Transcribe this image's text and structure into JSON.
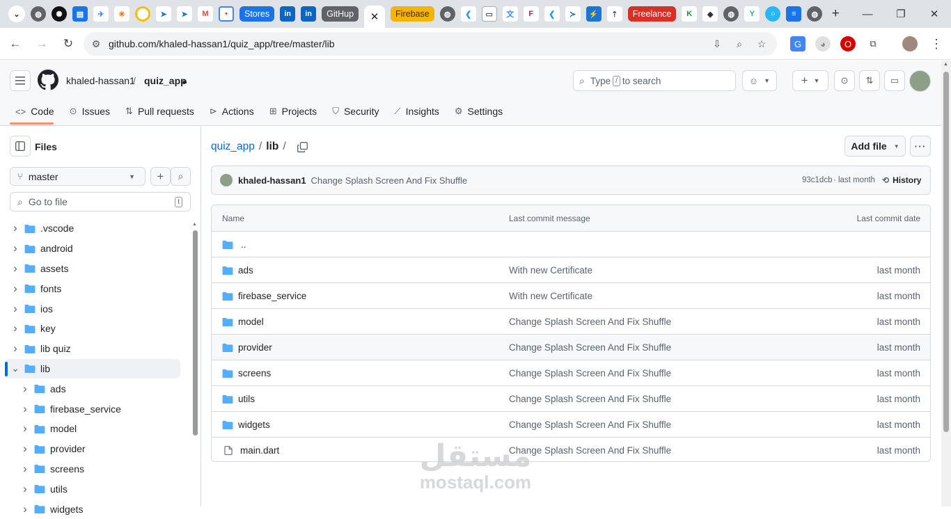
{
  "browser": {
    "tab_chips": [
      {
        "label": "Stores",
        "color": "#1a73e8"
      },
      {
        "label": "GitHup",
        "color": "#5f6368"
      },
      {
        "label": "Firebase",
        "color": "#f4b400"
      },
      {
        "label": "Freelance",
        "color": "#d93025"
      }
    ],
    "active_tab_close": "✕",
    "new_tab": "+",
    "url": "github.com/khaled-hassan1/quiz_app/tree/master/lib"
  },
  "header": {
    "owner": "khaled-hassan1",
    "separator": "/",
    "repo": "quiz_app",
    "search_placeholder_pre": "Type",
    "search_key": "/",
    "search_placeholder_post": "to search"
  },
  "repo_tabs": [
    {
      "label": "Code",
      "icon": "code-icon",
      "selected": true
    },
    {
      "label": "Issues",
      "icon": "issue-icon"
    },
    {
      "label": "Pull requests",
      "icon": "pull-request-icon"
    },
    {
      "label": "Actions",
      "icon": "play-icon"
    },
    {
      "label": "Projects",
      "icon": "table-icon"
    },
    {
      "label": "Security",
      "icon": "shield-icon"
    },
    {
      "label": "Insights",
      "icon": "graph-icon"
    },
    {
      "label": "Settings",
      "icon": "gear-icon"
    }
  ],
  "sidebar": {
    "title": "Files",
    "branch": "master",
    "goto_placeholder": "Go to file",
    "goto_key": "t",
    "tree": [
      {
        "label": ".vscode",
        "level": 0
      },
      {
        "label": "android",
        "level": 0
      },
      {
        "label": "assets",
        "level": 0
      },
      {
        "label": "fonts",
        "level": 0
      },
      {
        "label": "ios",
        "level": 0
      },
      {
        "label": "key",
        "level": 0
      },
      {
        "label": "lib quiz",
        "level": 0
      },
      {
        "label": "lib",
        "level": 0,
        "expanded": true,
        "selected": true
      },
      {
        "label": "ads",
        "level": 1
      },
      {
        "label": "firebase_service",
        "level": 1
      },
      {
        "label": "model",
        "level": 1
      },
      {
        "label": "provider",
        "level": 1
      },
      {
        "label": "screens",
        "level": 1
      },
      {
        "label": "utils",
        "level": 1
      },
      {
        "label": "widgets",
        "level": 1
      }
    ]
  },
  "main": {
    "path_repo": "quiz_app",
    "path_sep": "/",
    "path_dir": "lib",
    "path_trail": "/",
    "add_file": "Add file",
    "commit": {
      "author": "khaled-hassan1",
      "message": "Change Splash Screen And Fix Shuffle",
      "hash": "93c1dcb",
      "dot": "·",
      "when": "last month",
      "history": "History"
    },
    "columns": {
      "name": "Name",
      "message": "Last commit message",
      "date": "Last commit date"
    },
    "parent_dir": "..",
    "files": [
      {
        "name": "ads",
        "type": "dir",
        "message": "With new Certificate",
        "date": "last month"
      },
      {
        "name": "firebase_service",
        "type": "dir",
        "message": "With new Certificate",
        "date": "last month"
      },
      {
        "name": "model",
        "type": "dir",
        "message": "Change Splash Screen And Fix Shuffle",
        "date": "last month"
      },
      {
        "name": "provider",
        "type": "dir",
        "message": "Change Splash Screen And Fix Shuffle",
        "date": "last month"
      },
      {
        "name": "screens",
        "type": "dir",
        "message": "Change Splash Screen And Fix Shuffle",
        "date": "last month"
      },
      {
        "name": "utils",
        "type": "dir",
        "message": "Change Splash Screen And Fix Shuffle",
        "date": "last month"
      },
      {
        "name": "widgets",
        "type": "dir",
        "message": "Change Splash Screen And Fix Shuffle",
        "date": "last month"
      },
      {
        "name": "main.dart",
        "type": "file",
        "message": "Change Splash Screen And Fix Shuffle",
        "date": "last month"
      }
    ]
  },
  "watermark": {
    "arabic": "مستقل",
    "latin": "mostaql.com"
  }
}
